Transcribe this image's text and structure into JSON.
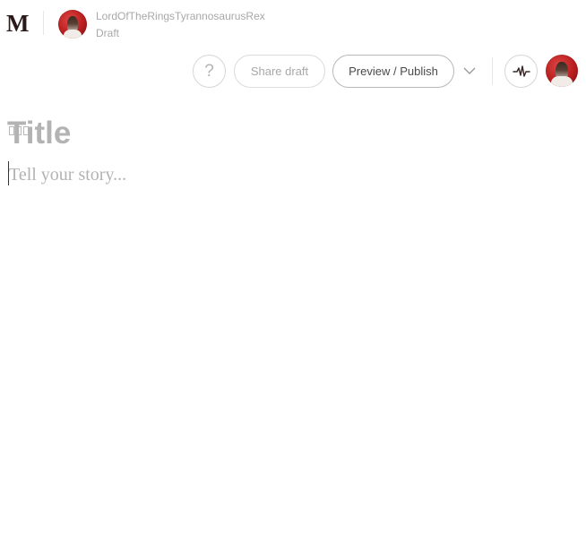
{
  "header": {
    "logo": "M",
    "author": "LordOfTheRingsTyrannosaurusRex",
    "status": "Draft",
    "avatar_icon": "user-avatar",
    "actions": {
      "help_label": "?",
      "share_label": "Share draft",
      "publish_label": "Preview / Publish",
      "more_icon": "chevron-down-icon",
      "activity_icon": "pulse-icon"
    }
  },
  "editor": {
    "title_placeholder": "Title",
    "story_placeholder": "Tell your story..."
  },
  "colors": {
    "logo": "#2b1a1a",
    "placeholder": "#b3b3b3",
    "muted_text": "#a8a8a8",
    "avatar_red": "#c62828"
  }
}
